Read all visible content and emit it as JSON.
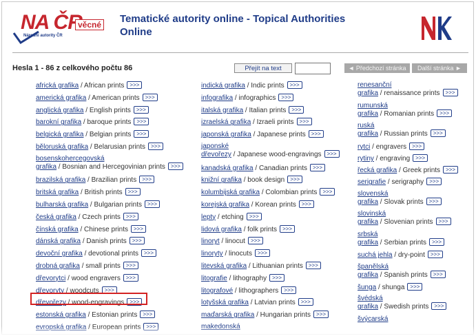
{
  "header": {
    "logo_main": "NA ČR",
    "logo_vecne": "věcné",
    "logo_sub": "Národní autority ČR",
    "title_line1": "Tematické autority online - Topical Authorities",
    "title_line2": "Online",
    "nk_logo": "NK"
  },
  "nav": {
    "status": "Hesla 1 - 86 z celkového počtu 86",
    "goto_label": "Přejít na text",
    "goto_value": "",
    "prev_label": "◄ Předchozí stránka",
    "next_label": "Další stránka ►"
  },
  "arrow_label": ">>>",
  "columns": [
    [
      {
        "cz": "africká grafika",
        "en": "African prints"
      },
      {
        "cz": "americká grafika",
        "en": "American prints"
      },
      {
        "cz": "anglická grafika",
        "en": "English prints"
      },
      {
        "cz": "barokní grafika",
        "en": "baroque prints"
      },
      {
        "cz": "belgická grafika",
        "en": "Belgian prints"
      },
      {
        "cz": "běloruská grafika",
        "en": "Belarusian prints"
      },
      {
        "cz1": "bosenskohercegovská",
        "cz2": "grafika",
        "en": "Bosnian and Hercegovinian prints"
      },
      {
        "cz": "brazilská grafika",
        "en": "Brazilian prints"
      },
      {
        "cz": "britská grafika",
        "en": "British prints"
      },
      {
        "cz": "bulharská grafika",
        "en": "Bulgarian prints"
      },
      {
        "cz": "česká grafika",
        "en": "Czech prints"
      },
      {
        "cz": "čínská grafika",
        "en": "Chinese prints"
      },
      {
        "cz": "dánská grafika",
        "en": "Danish prints"
      },
      {
        "cz": "devoční grafika",
        "en": "devotional prints"
      },
      {
        "cz": "drobná grafika",
        "en": "small prints"
      },
      {
        "cz": "dřevorytci",
        "en": "wood engravers"
      },
      {
        "cz": "dřevoryty",
        "en": "woodcuts"
      },
      {
        "cz": "dřevořezy",
        "en": "wood-engravings"
      },
      {
        "cz": "estonská grafika",
        "en": "Estonian prints"
      },
      {
        "cz": "evropská grafika",
        "en": "European prints"
      }
    ],
    [
      {
        "cz": "indická grafika",
        "en": "Indic prints"
      },
      {
        "cz": "infografika",
        "en": "infographics"
      },
      {
        "cz": "italská grafika",
        "en": "Italian prints"
      },
      {
        "cz": "izraelská grafika",
        "en": "Izraeli prints"
      },
      {
        "cz": "japonská grafika",
        "en": "Japanese prints"
      },
      {
        "cz1": "japonské",
        "cz2": "dřevořezy",
        "en": "Japanese wood-engravings"
      },
      {
        "cz": "kanadská grafika",
        "en": "Canadian prints"
      },
      {
        "cz": "knižní grafika",
        "en": "book design"
      },
      {
        "cz": "kolumbijská grafika",
        "en": "Colombian prints"
      },
      {
        "cz": "korejská grafika",
        "en": "Korean prints"
      },
      {
        "cz": "lepty",
        "en": "etching"
      },
      {
        "cz": "lidová grafika",
        "en": "folk prints"
      },
      {
        "cz": "linoryt",
        "en": "linocut"
      },
      {
        "cz": "linoryty",
        "en": "linocuts"
      },
      {
        "cz": "litevská grafika",
        "en": "Lithuanian prints"
      },
      {
        "cz": "litografie",
        "en": "lithography"
      },
      {
        "cz": "litografové",
        "en": "lithographers"
      },
      {
        "cz": "lotyšská grafika",
        "en": "Latvian prints"
      },
      {
        "cz": "maďarská grafika",
        "en": "Hungarian prints"
      },
      {
        "cz": "makedonská",
        "en": ""
      }
    ],
    [
      {
        "cz1": "renesanční",
        "cz2": "grafika",
        "en": "renaissance prints"
      },
      {
        "cz1": "rumunská",
        "cz2": "grafika",
        "en": "Romanian prints"
      },
      {
        "cz1": "ruská",
        "cz2": "grafika",
        "en": "Russian prints"
      },
      {
        "cz": "rytci",
        "en": "engravers"
      },
      {
        "cz": "rytiny",
        "en": "engraving"
      },
      {
        "cz": "řecká grafika",
        "en": "Greek prints"
      },
      {
        "cz": "serigrafie",
        "en": "serigraphy"
      },
      {
        "cz1": "slovenská",
        "cz2": "grafika",
        "en": "Slovak prints"
      },
      {
        "cz1": "slovinská",
        "cz2": "grafika",
        "en": "Slovenian prints"
      },
      {
        "cz1": "srbská",
        "cz2": "grafika",
        "en": "Serbian prints"
      },
      {
        "cz": "suchá jehla",
        "en": "dry-point"
      },
      {
        "cz1": "španělská",
        "cz2": "grafika",
        "en": "Spanish prints"
      },
      {
        "cz": "šunga",
        "en": "shunga"
      },
      {
        "cz1": "švédská",
        "cz2": "grafika",
        "en": "Swedish prints"
      },
      {
        "cz1": "švýcarská",
        "cz2": "",
        "en": ""
      }
    ]
  ],
  "highlight_entry": "dřevoryty / woodcuts",
  "colors": {
    "link": "#1f3c88",
    "logo_red": "#c6262e",
    "highlight": "#d32222",
    "nav_disabled": "#a8a8a8"
  }
}
